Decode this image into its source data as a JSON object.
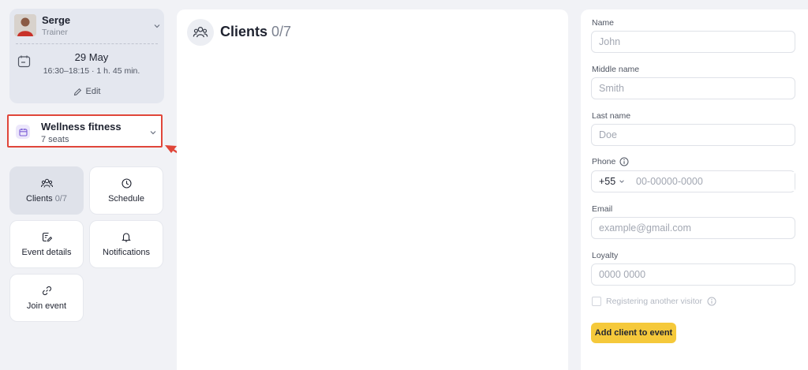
{
  "trainer": {
    "name": "Serge",
    "role": "Trainer"
  },
  "event": {
    "date": "29 May",
    "time": "16:30–18:15 · 1 h. 45 min.",
    "edit_label": "Edit"
  },
  "activity": {
    "title": "Wellness fitness",
    "seats": "7 seats"
  },
  "menu": {
    "clients_label": "Clients",
    "clients_count": "0/7",
    "schedule_label": "Schedule",
    "event_details_label": "Event details",
    "notifications_label": "Notifications",
    "join_event_label": "Join event"
  },
  "clients_panel": {
    "title": "Clients",
    "count": "0/7"
  },
  "form": {
    "name_label": "Name",
    "name_placeholder": "John",
    "middle_label": "Middle name",
    "middle_placeholder": "Smith",
    "last_label": "Last name",
    "last_placeholder": "Doe",
    "phone_label": "Phone",
    "phone_code": "+55",
    "phone_placeholder": "00-00000-0000",
    "email_label": "Email",
    "email_placeholder": "example@gmail.com",
    "loyalty_label": "Loyalty",
    "loyalty_placeholder": "0000 0000",
    "another_visitor_label": "Registering another visitor",
    "submit_label": "Add client to event"
  },
  "colors": {
    "accent_button": "#f5c93b",
    "highlight_box": "#e0463a",
    "activity_icon": "#7b5cd6"
  }
}
